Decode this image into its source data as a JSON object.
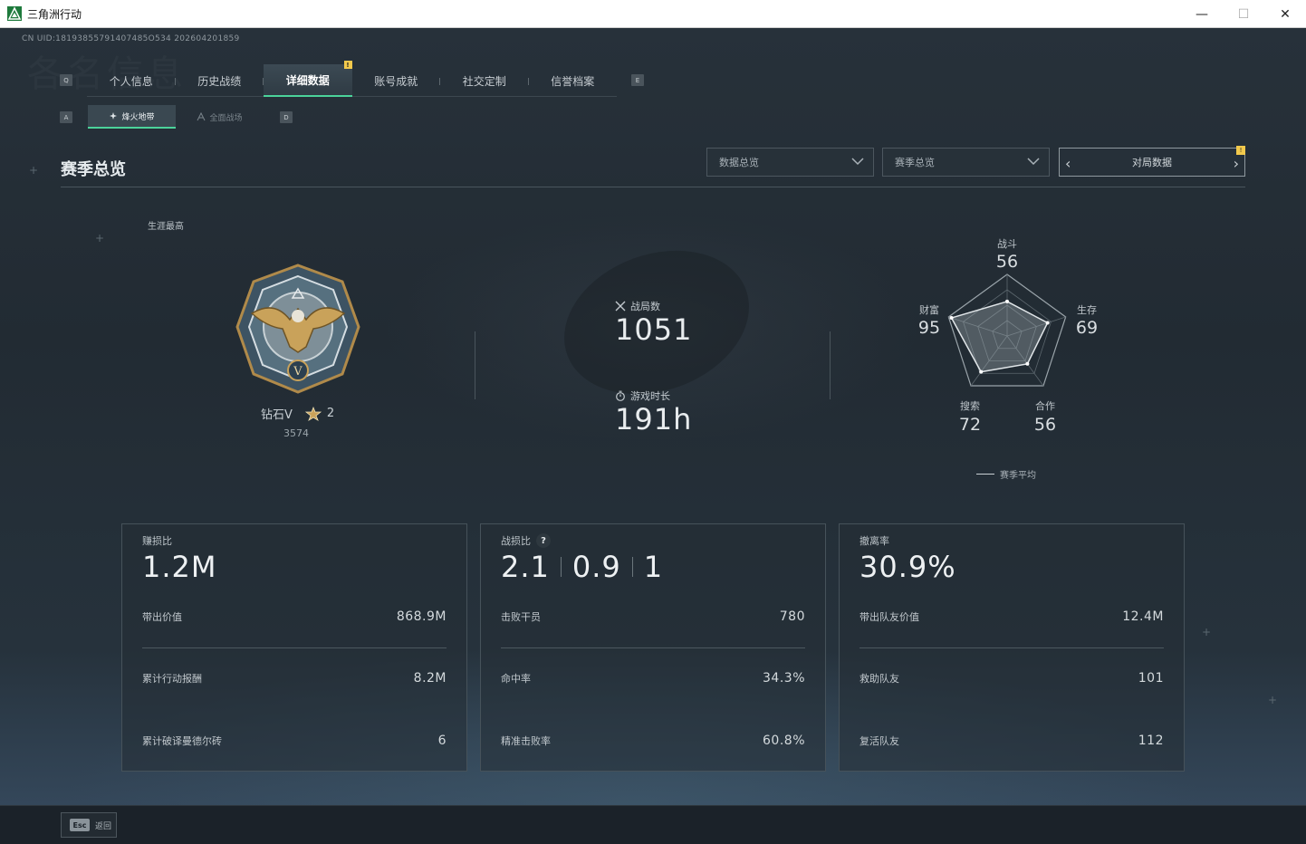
{
  "window": {
    "title": "三角洲行动",
    "controls": {
      "minimize": "—",
      "maximize": "☐",
      "close": "✕"
    }
  },
  "uid": "CN UID:18193855791407485O534 202604201859",
  "watermark": "各名信息",
  "tabs": {
    "left_key": "Q",
    "right_key": "E",
    "items": [
      {
        "label": "个人信息"
      },
      {
        "label": "历史战绩"
      },
      {
        "label": "详细数据",
        "active": true,
        "badge": "!"
      },
      {
        "label": "账号成就"
      },
      {
        "label": "社交定制"
      },
      {
        "label": "信誉档案"
      }
    ]
  },
  "subtabs": {
    "left_key": "A",
    "right_key": "D",
    "items": [
      {
        "label": "烽火地带",
        "active": true,
        "icon": "fire-zone-icon"
      },
      {
        "label": "全面战场",
        "icon": "battlefield-icon"
      }
    ]
  },
  "section": {
    "title": "赛季总览"
  },
  "filters": {
    "data_dropdown": "数据总览",
    "season_dropdown": "赛季总览",
    "match_data": "对局数据",
    "match_badge": "!"
  },
  "rank": {
    "career_label": "生涯最高",
    "name": "钻石V",
    "stars": "2",
    "score": "3574"
  },
  "middle_stats": {
    "matches_label": "战局数",
    "matches_value": "1051",
    "playtime_label": "游戏时长",
    "playtime_value": "191h"
  },
  "radar": {
    "axes": [
      {
        "label": "战斗",
        "value": "56",
        "score": 56
      },
      {
        "label": "生存",
        "value": "69",
        "score": 69
      },
      {
        "label": "合作",
        "value": "56",
        "score": 56
      },
      {
        "label": "搜索",
        "value": "72",
        "score": 72
      },
      {
        "label": "财富",
        "value": "95",
        "score": 95
      }
    ],
    "legend": "赛季平均"
  },
  "cards": [
    {
      "label": "赚损比",
      "big": "1.2M",
      "rows": [
        {
          "key": "带出价值",
          "value": "868.9M"
        },
        {
          "key": "累计行动报酬",
          "value": "8.2M"
        },
        {
          "key": "累计破译曼德尔砖",
          "value": "6"
        }
      ]
    },
    {
      "label": "战损比",
      "help": "?",
      "big_parts": [
        "2.1",
        "0.9",
        "1"
      ],
      "rows": [
        {
          "key": "击败干员",
          "value": "780"
        },
        {
          "key": "命中率",
          "value": "34.3%"
        },
        {
          "key": "精准击败率",
          "value": "60.8%"
        }
      ]
    },
    {
      "label": "撤离率",
      "big": "30.9%",
      "rows": [
        {
          "key": "带出队友价值",
          "value": "12.4M"
        },
        {
          "key": "救助队友",
          "value": "101"
        },
        {
          "key": "复活队友",
          "value": "112"
        }
      ]
    }
  ],
  "bottom": {
    "esc_key": "Esc",
    "esc_label": "返回"
  },
  "colors": {
    "accent": "#4bd39a",
    "badge": "#f2c94c"
  }
}
